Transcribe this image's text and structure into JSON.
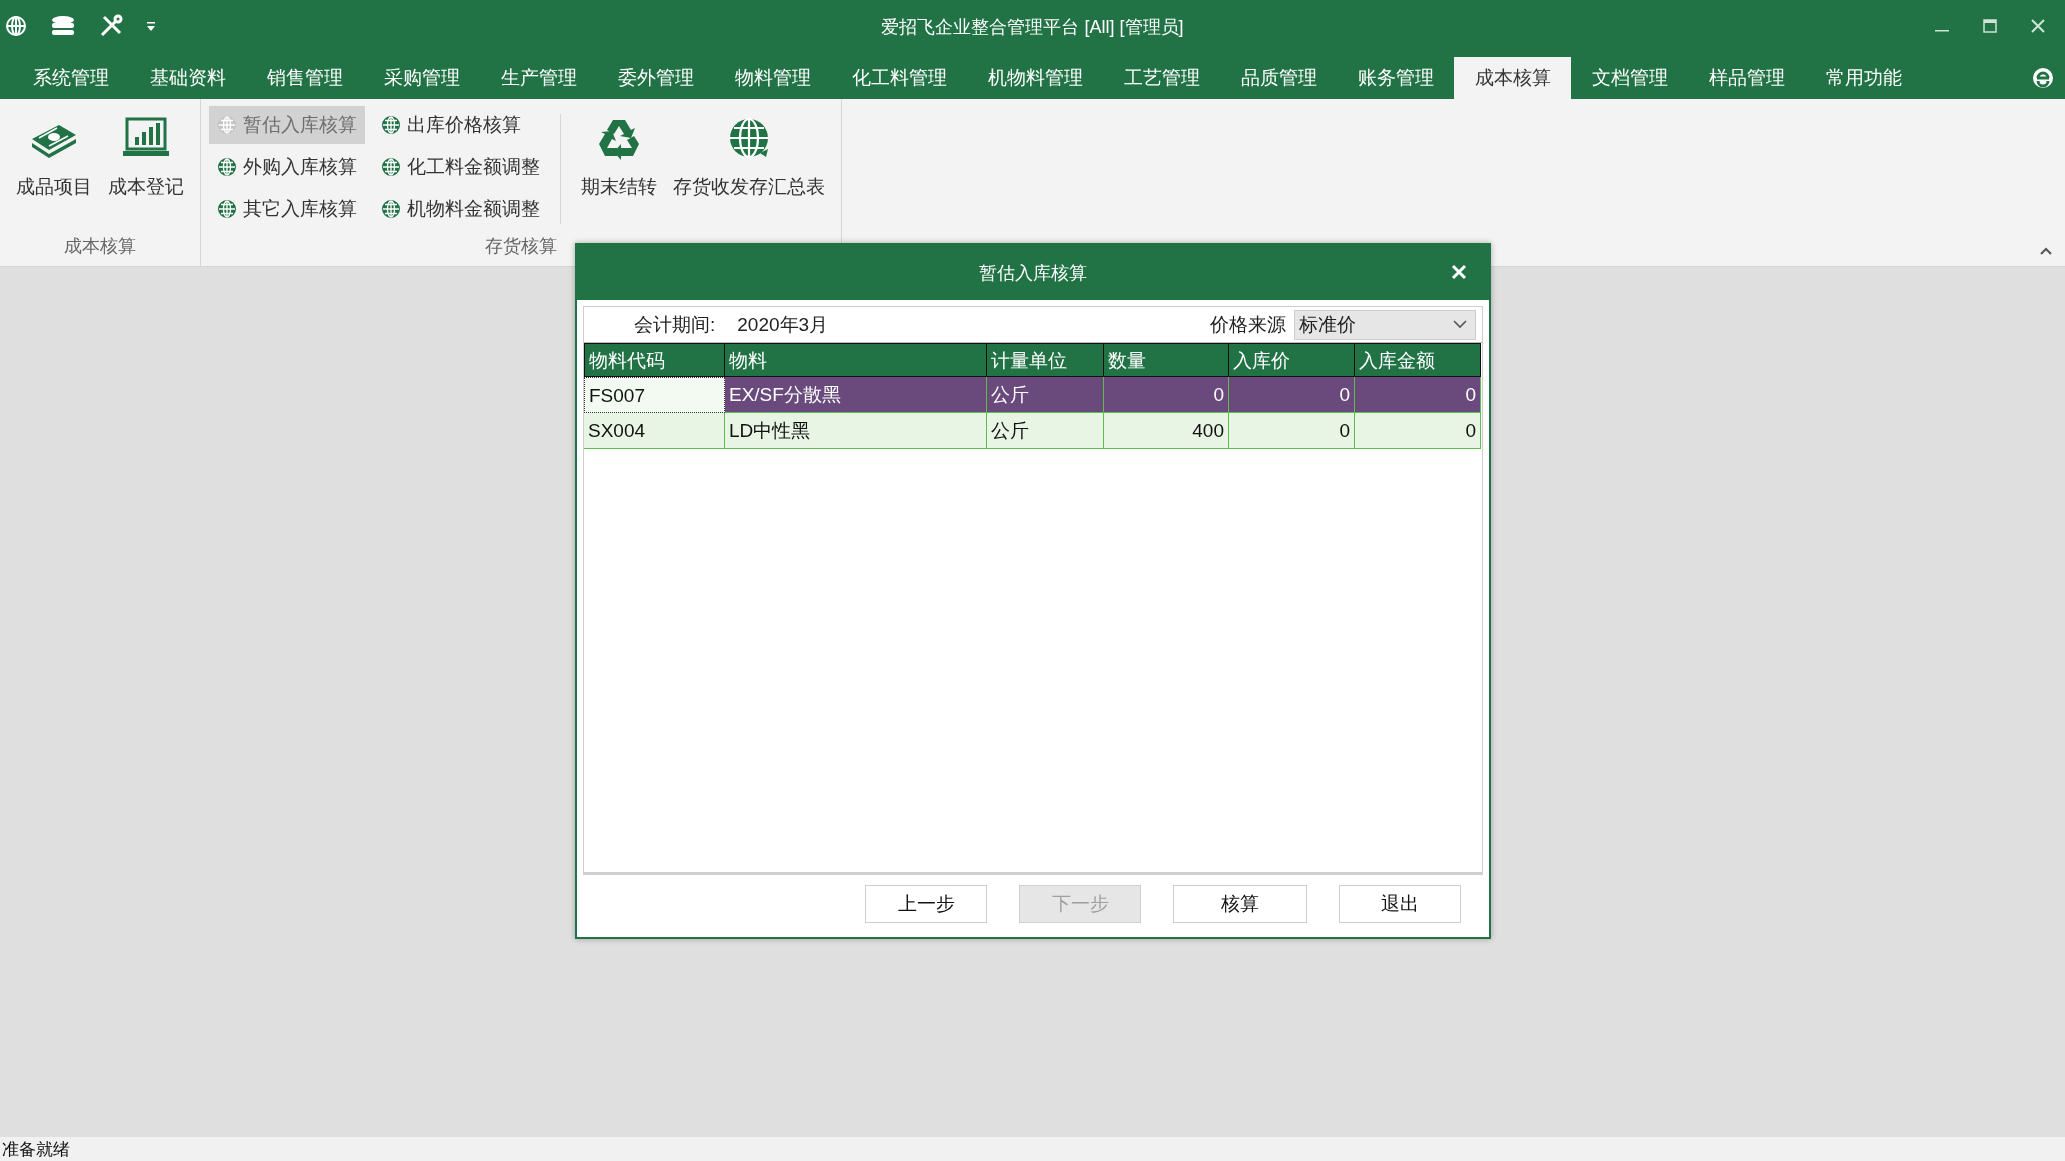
{
  "window": {
    "title": "爱招飞企业整合管理平台 [All] [管理员]"
  },
  "menu_tabs": [
    {
      "label": "系统管理",
      "selected": false
    },
    {
      "label": "基础资料",
      "selected": false
    },
    {
      "label": "销售管理",
      "selected": false
    },
    {
      "label": "采购管理",
      "selected": false
    },
    {
      "label": "生产管理",
      "selected": false
    },
    {
      "label": "委外管理",
      "selected": false
    },
    {
      "label": "物料管理",
      "selected": false
    },
    {
      "label": "化工料管理",
      "selected": false
    },
    {
      "label": "机物料管理",
      "selected": false
    },
    {
      "label": "工艺管理",
      "selected": false
    },
    {
      "label": "品质管理",
      "selected": false
    },
    {
      "label": "账务管理",
      "selected": false
    },
    {
      "label": "成本核算",
      "selected": true
    },
    {
      "label": "文档管理",
      "selected": false
    },
    {
      "label": "样品管理",
      "selected": false
    },
    {
      "label": "常用功能",
      "selected": false
    }
  ],
  "ribbon": {
    "groups": [
      {
        "label": "成本核算",
        "items": [
          {
            "kind": "large",
            "label": "成品项目",
            "disabled": false
          },
          {
            "kind": "large",
            "label": "成本登记",
            "disabled": false
          }
        ]
      },
      {
        "label": "存货核算",
        "items": [
          {
            "kind": "small",
            "label": "暂估入库核算",
            "disabled": true
          },
          {
            "kind": "small",
            "label": "外购入库核算",
            "disabled": false
          },
          {
            "kind": "small",
            "label": "其它入库核算",
            "disabled": false
          },
          {
            "kind": "small",
            "label": "出库价格核算",
            "disabled": false
          },
          {
            "kind": "small",
            "label": "化工料金额调整",
            "disabled": false
          },
          {
            "kind": "small",
            "label": "机物料金额调整",
            "disabled": false
          },
          {
            "kind": "large",
            "label": "期末结转",
            "disabled": false
          },
          {
            "kind": "large",
            "label": "存货收发存汇总表",
            "disabled": false
          }
        ]
      }
    ]
  },
  "dialog": {
    "title": "暂估入库核算",
    "period_label": "会计期间:",
    "period_value": "2020年3月",
    "price_source_label": "价格来源",
    "price_source_value": "标准价",
    "table": {
      "columns": [
        {
          "label": "物料代码",
          "kind": "text"
        },
        {
          "label": "物料",
          "kind": "text"
        },
        {
          "label": "计量单位",
          "kind": "text"
        },
        {
          "label": "数量",
          "kind": "number"
        },
        {
          "label": "入库价",
          "kind": "number"
        },
        {
          "label": "入库金额",
          "kind": "number"
        }
      ],
      "rows": [
        {
          "selected": true,
          "cells": [
            "FS007",
            "EX/SF分散黑",
            "公斤",
            "0",
            "0",
            "0"
          ]
        },
        {
          "selected": false,
          "cells": [
            "SX004",
            "LD中性黑",
            "公斤",
            "400",
            "0",
            "0"
          ]
        }
      ]
    },
    "buttons": [
      {
        "label": "上一步",
        "disabled": false
      },
      {
        "label": "下一步",
        "disabled": true
      },
      {
        "label": "核算",
        "disabled": false
      },
      {
        "label": "退出",
        "disabled": false
      }
    ]
  },
  "status_bar": {
    "text": "准备就绪"
  }
}
